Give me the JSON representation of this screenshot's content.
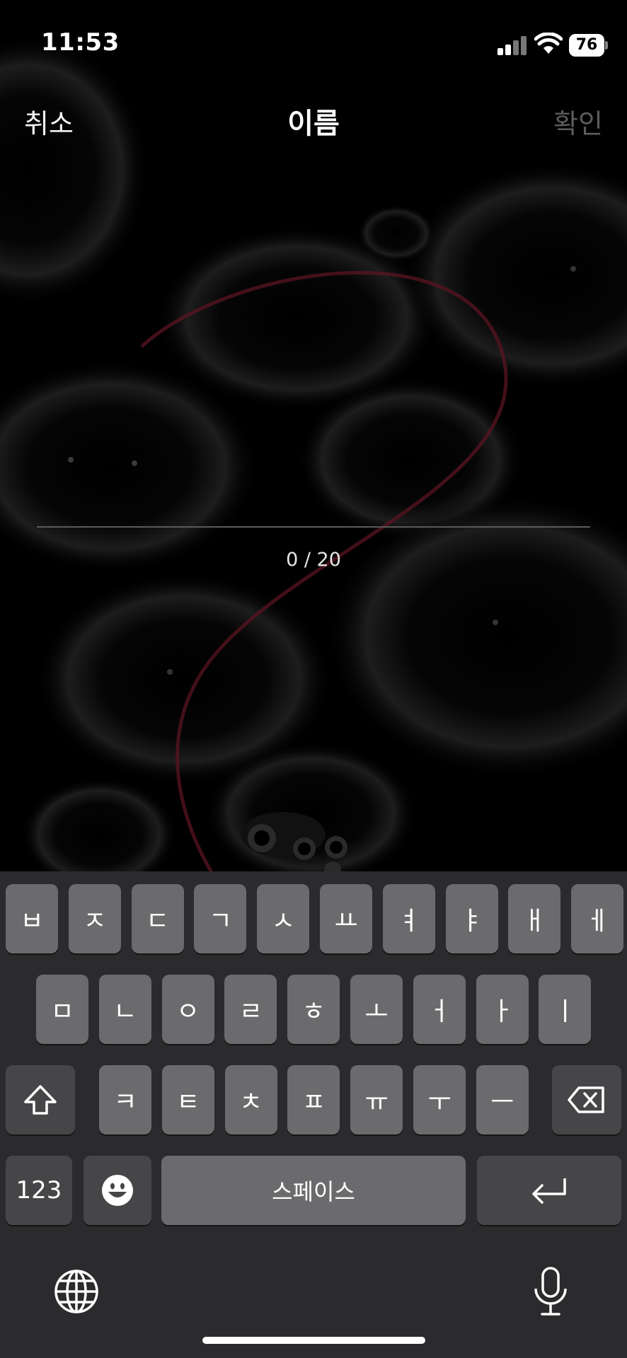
{
  "status_bar": {
    "time": "11:53",
    "battery": "76",
    "signal_icon": "cellular-signal-icon",
    "wifi_icon": "wifi-icon"
  },
  "nav": {
    "cancel_label": "취소",
    "title": "이름",
    "confirm_label": "확인"
  },
  "name_field": {
    "value": "",
    "placeholder": ""
  },
  "char_counter": "0 / 20",
  "colors": {
    "background": "#000000",
    "confirm_disabled": "#5c5c5c",
    "keyboard_bg": "#2b2a2d",
    "key": "#6b6b6d",
    "key_dark": "#464648",
    "accent_red": "#5a1420"
  },
  "keyboard": {
    "row1": [
      "ㅂ",
      "ㅈ",
      "ㄷ",
      "ㄱ",
      "ㅅ",
      "ㅛ",
      "ㅕ",
      "ㅑ",
      "ㅐ",
      "ㅔ"
    ],
    "row2": [
      "ㅁ",
      "ㄴ",
      "ㅇ",
      "ㄹ",
      "ㅎ",
      "ㅗ",
      "ㅓ",
      "ㅏ",
      "ㅣ"
    ],
    "row3": [
      "ㅋ",
      "ㅌ",
      "ㅊ",
      "ㅍ",
      "ㅠ",
      "ㅜ",
      "ㅡ"
    ],
    "numbers_label": "123",
    "space_label": "스페이스",
    "shift_icon": "shift-icon",
    "delete_icon": "delete-icon",
    "emoji_icon": "emoji-icon",
    "return_icon": "return-icon",
    "globe_icon": "globe-icon",
    "mic_icon": "microphone-icon"
  }
}
